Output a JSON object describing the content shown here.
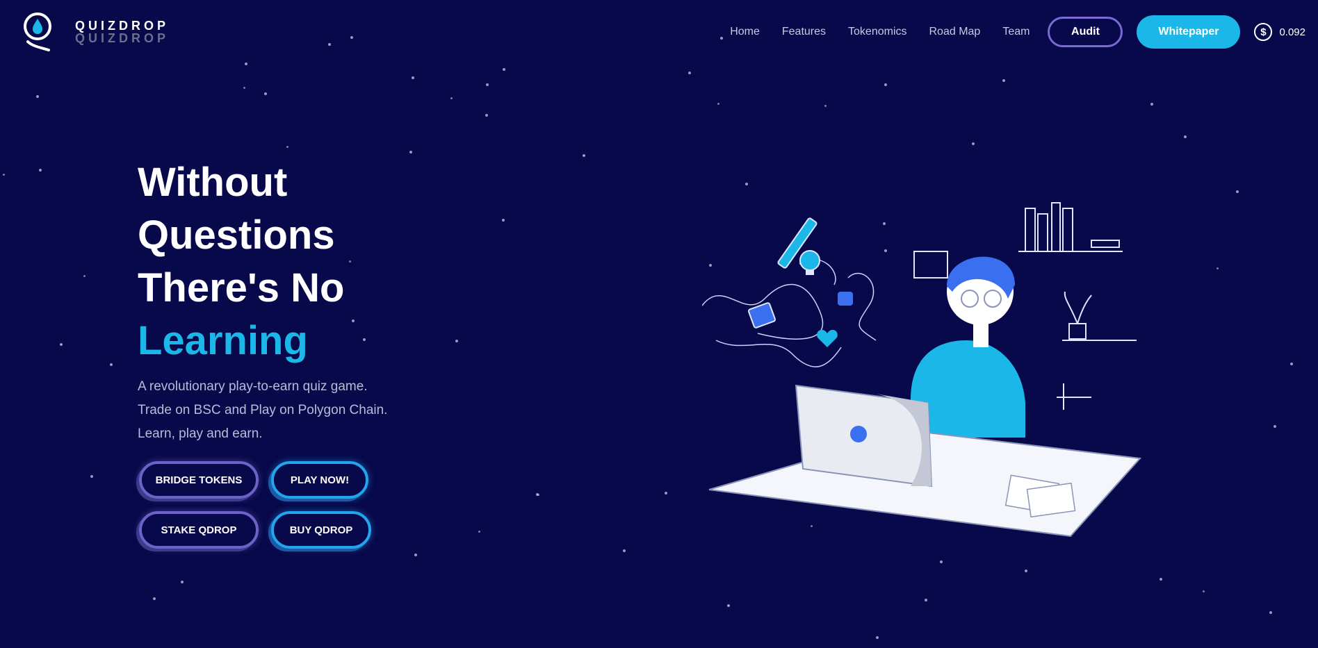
{
  "brand": {
    "name": "QUIZDROP",
    "name_shadow": "QUIZDROP",
    "logo_icon": "drop-in-magnifier-icon"
  },
  "nav": {
    "links": [
      "Home",
      "Features",
      "Tokenomics",
      "Road Map",
      "Team"
    ],
    "audit_label": "Audit",
    "whitepaper_label": "Whitepaper",
    "price_icon": "dollar-circle-icon",
    "price_value": "0.092"
  },
  "hero": {
    "title_lines": [
      "Without",
      "Questions",
      "There's No"
    ],
    "title_accent": "Learning",
    "description_lines": [
      "A revolutionary play-to-earn quiz game.",
      "Trade on BSC and Play on Polygon Chain.",
      "Learn, play and earn."
    ],
    "buttons": {
      "bridge": "BRIDGE TOKENS",
      "play": "PLAY NOW!",
      "stake": "STAKE QDROP",
      "buy": "BUY QDROP"
    }
  },
  "colors": {
    "background": "#08094a",
    "accent": "#1ab7e8",
    "purple_border": "#6e62c9",
    "blue_border": "#21a6ee"
  }
}
